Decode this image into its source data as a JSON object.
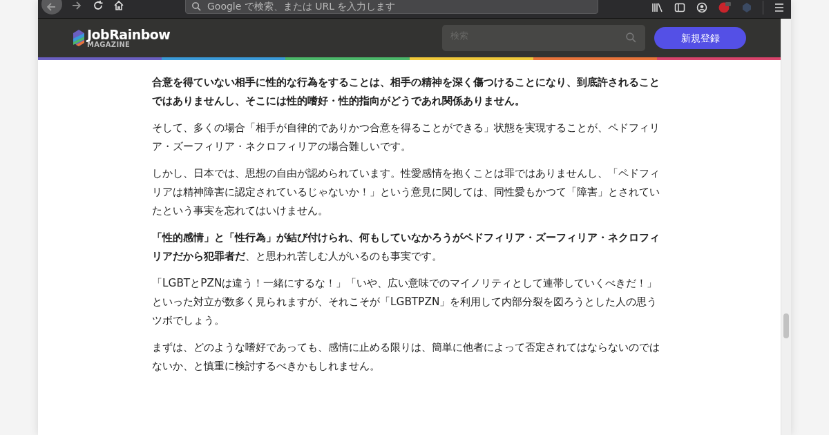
{
  "browser": {
    "url_placeholder": "Google で検索、または URL を入力します"
  },
  "site_header": {
    "logo_title": "JobRainbow",
    "logo_subtitle": "MAGAZINE",
    "search_placeholder": "検索",
    "signup_button": "新規登録"
  },
  "article": {
    "paragraphs": [
      {
        "text": "合意を得ていない相手に性的な行為をすることは、相手の精神を深く傷つけることになり、到底許されることではありませんし、そこには性的嗜好・性的指向がどうであれ関係ありません。",
        "bold": true
      },
      {
        "text": "そして、多くの場合「相手が自律的でありかつ合意を得ることができる」状態を実現することが、ペドフィリア・ズーフィリア・ネクロフィリアの場合難しいです。",
        "bold": false
      },
      {
        "text": "しかし、日本では、思想の自由が認められています。性愛感情を抱くことは罪ではありませんし、「ペドフィリアは精神障害に認定されているじゃないか！」という意見に関しては、同性愛もかつて「障害」とされていたという事実を忘れてはいけません。",
        "bold": false
      },
      {
        "text": "**「性的感情」と「性行為」が結び付けられ、何もしていなかろうがペドフィリア・ズーフィリア・ネクロフィリアだから犯罪者だ**、と思われ苦しむ人がいるのも事実です。",
        "bold": false
      },
      {
        "text": "「LGBTとPZNは違う！一緒にするな！」「いや、広い意味でのマイノリティとして連帯していくべきだ！」といった対立が数多く見られますが、それこそが「LGBTPZN」を利用して内部分裂を図ろうとした人の思うツボでしょう。",
        "bold": false
      },
      {
        "text": "まずは、どのような嗜好であっても、感情に止める限りは、簡単に他者によって否定されてはならないのではないか、と慎重に検討するべきかもしれません。",
        "bold": false
      }
    ]
  }
}
